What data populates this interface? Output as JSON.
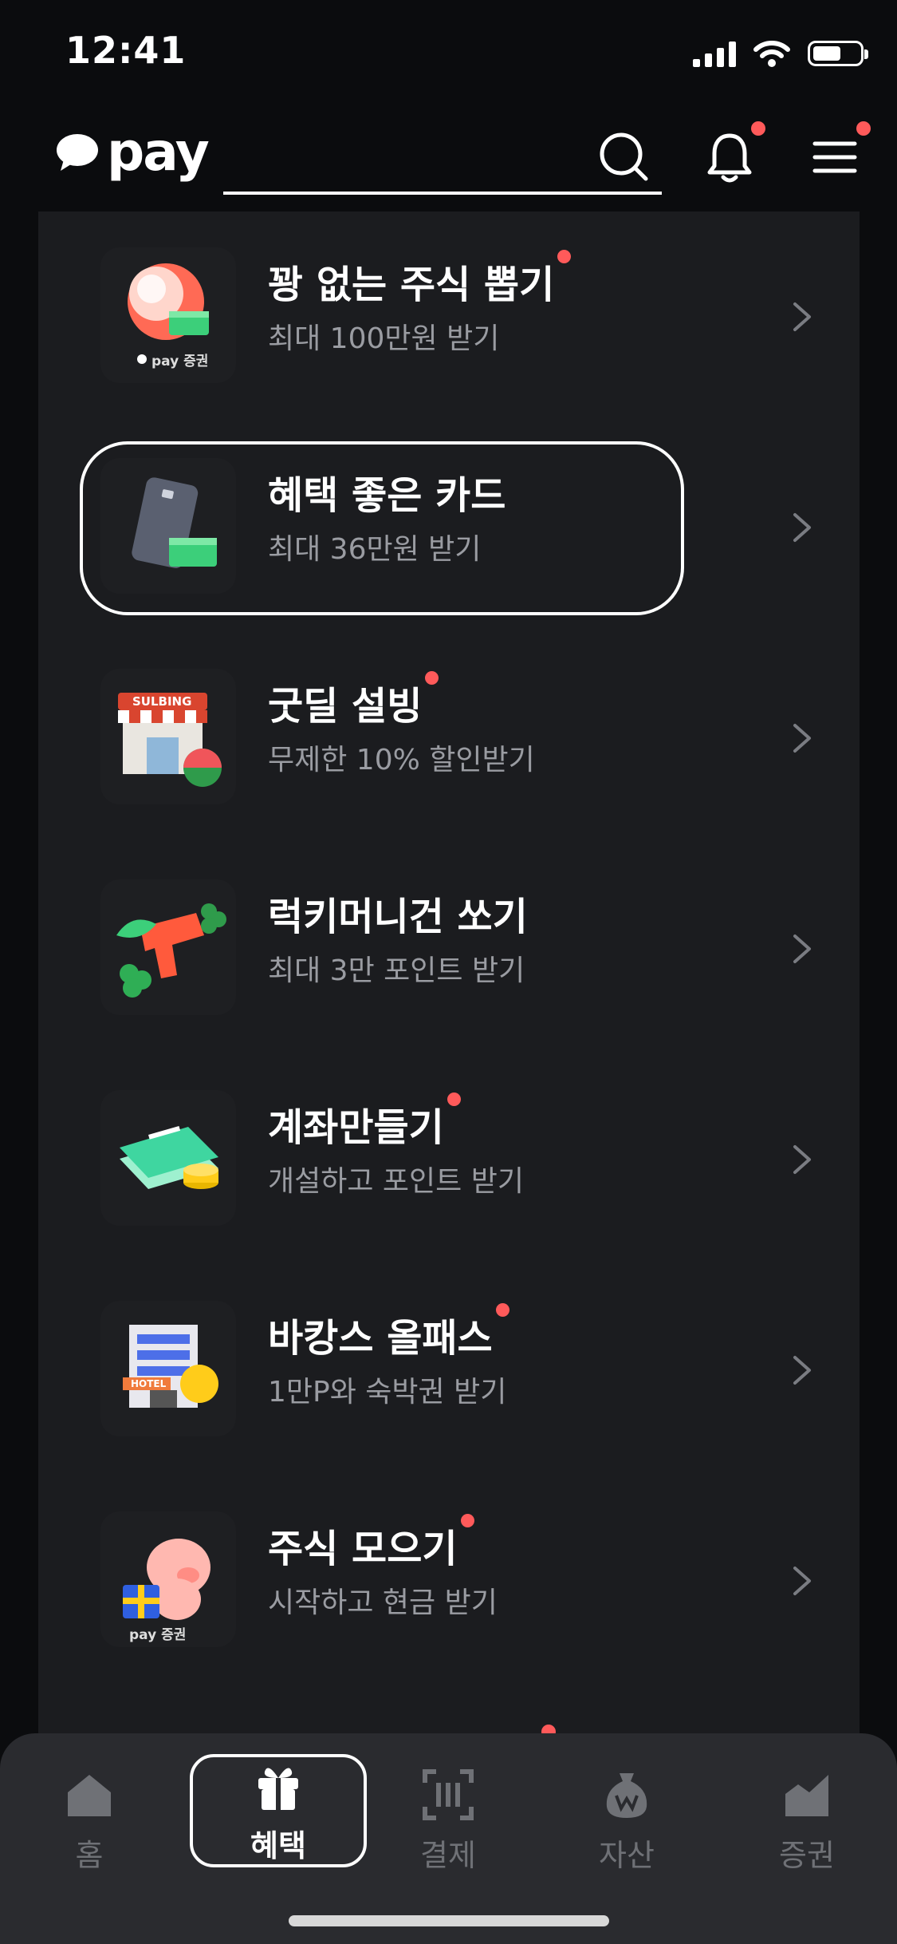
{
  "status_bar": {
    "time": "12:41"
  },
  "header": {
    "logo_text": "pay"
  },
  "benefits": [
    {
      "title": "꽝 없는 주식 뽑기",
      "subtitle": "최대 100만원 받기",
      "new": true,
      "icon": "ball-cash-icon",
      "badge": "pay 증권"
    },
    {
      "title": "혜택 좋은 카드",
      "subtitle": "최대 36만원 받기",
      "new": false,
      "icon": "card-cash-icon"
    },
    {
      "title": "굿딜 설빙",
      "subtitle": "무제한 10% 할인받기",
      "new": true,
      "icon": "sulbing-store-icon",
      "store_sign": "SULBING"
    },
    {
      "title": "럭키머니건 쏘기",
      "subtitle": "최대 3만 포인트 받기",
      "new": false,
      "icon": "money-gun-icon"
    },
    {
      "title": "계좌만들기",
      "subtitle": "개설하고 포인트 받기",
      "new": true,
      "icon": "bankbook-coins-icon"
    },
    {
      "title": "바캉스 올패스",
      "subtitle": "1만P와 숙박권 받기",
      "new": true,
      "icon": "hotel-coin-icon",
      "hotel_sign": "HOTEL"
    },
    {
      "title": "주식 모으기",
      "subtitle": "시작하고 현금 받기",
      "new": true,
      "icon": "piggy-gift-icon",
      "badge": "pay 증권"
    }
  ],
  "tabs": [
    {
      "label": "홈",
      "icon": "home-icon",
      "active": false
    },
    {
      "label": "혜택",
      "icon": "gift-icon",
      "active": true
    },
    {
      "label": "결제",
      "icon": "barcode-scan-icon",
      "active": false
    },
    {
      "label": "자산",
      "icon": "money-bag-icon",
      "active": false
    },
    {
      "label": "증권",
      "icon": "chart-icon",
      "active": false
    }
  ],
  "colors": {
    "accent_dot": "#ff5a5a",
    "panel": "#1b1c1f",
    "background": "#0b0c0e"
  }
}
